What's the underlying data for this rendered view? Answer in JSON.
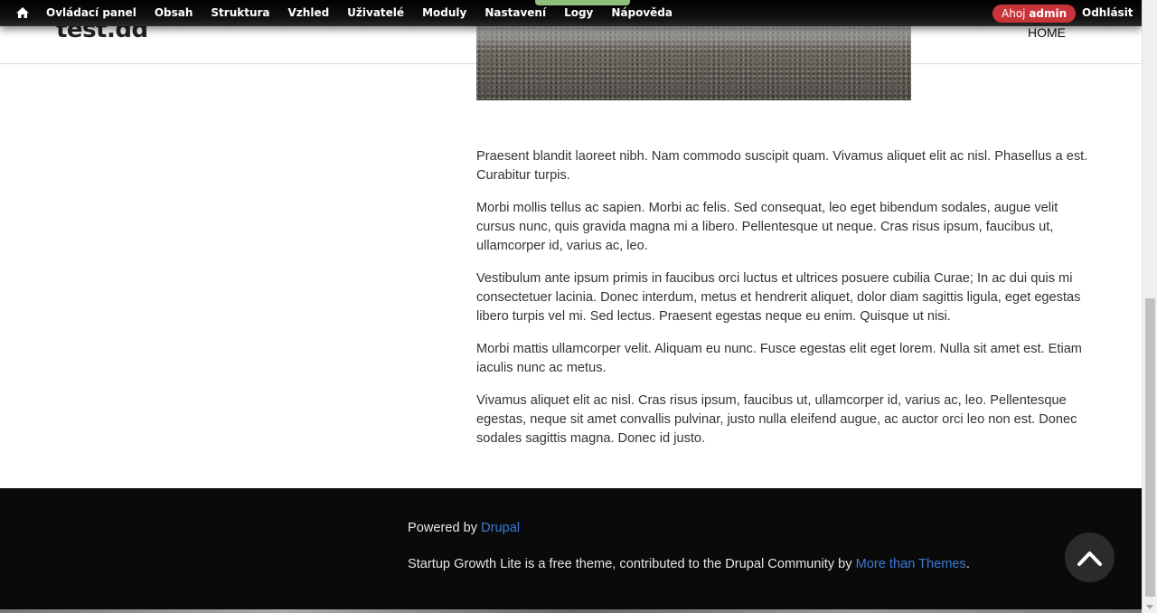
{
  "toolbar": {
    "items": [
      "Ovládací panel",
      "Obsah",
      "Struktura",
      "Vzhled",
      "Uživatelé",
      "Moduly",
      "Nastavení",
      "Logy",
      "Nápověda"
    ],
    "greeting_prefix": "Ahoj ",
    "greeting_user": "admin",
    "logout": "Odhlásit"
  },
  "header": {
    "site_name": "test.dd",
    "menu_home": "HOME"
  },
  "article": {
    "paragraphs": [
      "Praesent blandit laoreet nibh. Nam commodo suscipit quam. Vivamus aliquet elit ac nisl. Phasellus a est. Curabitur turpis.",
      "Morbi mollis tellus ac sapien. Morbi ac felis. Sed consequat, leo eget bibendum sodales, augue velit cursus nunc, quis gravida magna mi a libero. Pellentesque ut neque. Cras risus ipsum, faucibus ut, ullamcorper id, varius ac, leo.",
      "Vestibulum ante ipsum primis in faucibus orci luctus et ultrices posuere cubilia Curae; In ac dui quis mi consectetuer lacinia. Donec interdum, metus et hendrerit aliquet, dolor diam sagittis ligula, eget egestas libero turpis vel mi. Sed lectus. Praesent egestas neque eu enim. Quisque ut nisi.",
      "Morbi mattis ullamcorper velit. Aliquam eu nunc. Fusce egestas elit eget lorem. Nulla sit amet est. Etiam iaculis nunc ac metus.",
      "Vivamus aliquet elit ac nisl. Cras risus ipsum, faucibus ut, ullamcorper id, varius ac, leo. Pellentesque egestas, neque sit amet convallis pulvinar, justo nulla eleifend augue, ac auctor orci leo non est. Donec sodales sagittis magna. Donec id justo."
    ]
  },
  "footer": {
    "powered_prefix": "Powered by ",
    "powered_link": "Drupal",
    "credits_prefix": "Startup Growth Lite is a free theme, contributed to the Drupal Community by ",
    "credits_link": "More than Themes",
    "credits_suffix": "."
  },
  "icons": {
    "home": "home-icon",
    "scroll_top": "chevron-up-icon"
  },
  "colors": {
    "toolbar_bg": "#000000",
    "greeting_bg": "#c9343a",
    "footer_bg": "#0a0a0b",
    "link": "#3b7bd6"
  }
}
